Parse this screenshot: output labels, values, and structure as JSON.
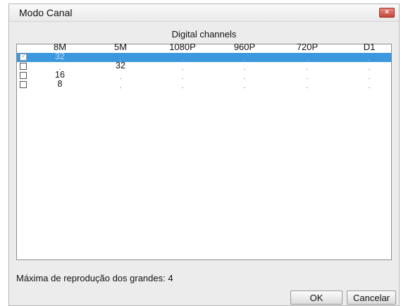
{
  "window": {
    "title": "Modo Canal",
    "close_glyph": "×"
  },
  "group": {
    "title": "Digital channels"
  },
  "columns": [
    "8M",
    "5M",
    "1080P",
    "960P",
    "720P",
    "D1"
  ],
  "rows": [
    {
      "checked": true,
      "selected": true,
      "cells": [
        "32",
        ".",
        ".",
        ".",
        ".",
        "."
      ]
    },
    {
      "checked": false,
      "selected": false,
      "cells": [
        ".",
        "32",
        ".",
        ".",
        ".",
        "."
      ]
    },
    {
      "checked": false,
      "selected": false,
      "cells": [
        "16",
        ".",
        ".",
        ".",
        ".",
        "."
      ]
    },
    {
      "checked": false,
      "selected": false,
      "cells": [
        "8",
        ".",
        ".",
        ".",
        ".",
        "."
      ]
    }
  ],
  "footer": {
    "max_playback_text": "Máxima de reprodução dos grandes: 4"
  },
  "buttons": {
    "ok": "OK",
    "cancel": "Cancelar"
  },
  "colors": {
    "selection": "#3c98de",
    "close_button": "#c4463a"
  }
}
